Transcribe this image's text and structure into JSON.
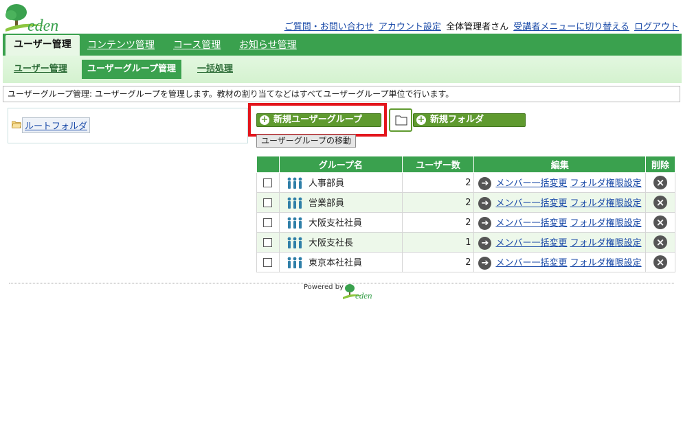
{
  "header": {
    "logo_text": "eden",
    "links": {
      "contact": "ご質問・お問い合わせ",
      "account": "アカウント設定",
      "user": "全体管理者さん",
      "switch_menu": "受講者メニューに切り替える",
      "logout": "ログアウト"
    }
  },
  "main_nav": {
    "tabs": [
      "ユーザー管理",
      "コンテンツ管理",
      "コース管理",
      "お知らせ管理"
    ],
    "active": "ユーザー管理"
  },
  "sub_nav": {
    "tabs": [
      "ユーザー管理",
      "ユーザーグループ管理",
      "一括処理"
    ],
    "active": "ユーザーグループ管理"
  },
  "description": "ユーザーグループ管理: ユーザーグループを管理します。教材の割り当てなどはすべてユーザーグループ単位で行います。",
  "tree": {
    "root_label": "ルートフォルダ"
  },
  "actions": {
    "new_group": "新規ユーザーグループ",
    "new_folder": "新規フォルダ",
    "move_group": "ユーザーグループの移動"
  },
  "table": {
    "headers": {
      "select": "",
      "name": "グループ名",
      "count": "ユーザー数",
      "edit": "編集",
      "delete": "削除"
    },
    "edit_links": {
      "members": "メンバー一括変更",
      "folder_perm": "フォルダ権限設定"
    },
    "rows": [
      {
        "name": "人事部員",
        "count": "2"
      },
      {
        "name": "営業部員",
        "count": "2"
      },
      {
        "name": "大阪支社社員",
        "count": "2"
      },
      {
        "name": "大阪支社長",
        "count": "1"
      },
      {
        "name": "東京本社社員",
        "count": "2"
      }
    ]
  },
  "footer": {
    "powered_by": "Powered by",
    "logo_text": "eden"
  },
  "colors": {
    "brand_green": "#3aa14e",
    "button_green": "#5f9a2f",
    "highlight": "#e3151c"
  }
}
